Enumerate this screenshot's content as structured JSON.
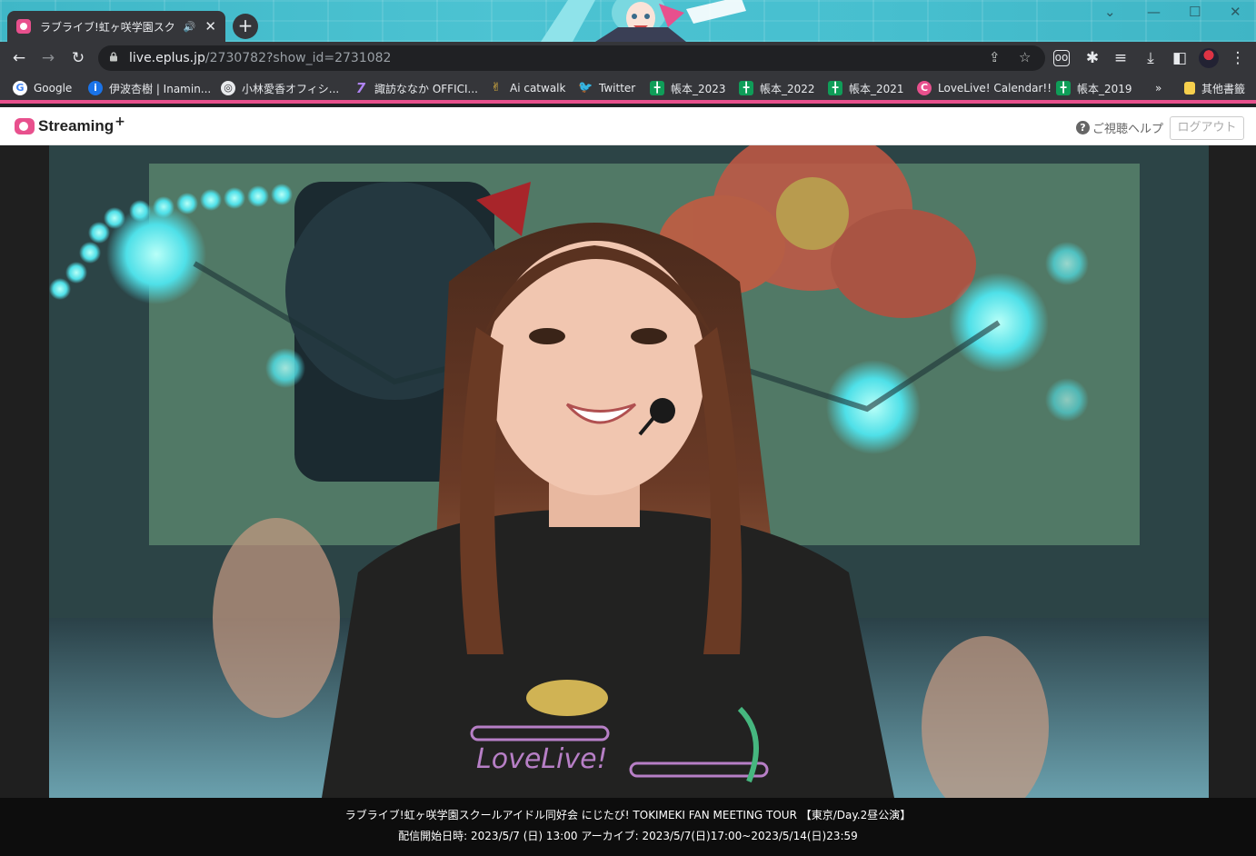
{
  "browser": {
    "tab_title": "ラブライブ!虹ヶ咲学園スク",
    "tab_audio_icon": "speaker-icon",
    "url_host": "live.eplus.jp",
    "url_path": "/2730782?show_id=2731082"
  },
  "bookmarks": [
    {
      "label": "Google",
      "icon": "google-icon",
      "color": "#ffffff"
    },
    {
      "label": "伊波杏樹 | Inamin...",
      "icon": "info-icon",
      "color": "#1a73e8"
    },
    {
      "label": "小林愛香オフィシ...",
      "icon": "globe-icon",
      "color": "#e8eaed"
    },
    {
      "label": "諏訪ななか OFFICI...",
      "icon": "seven-icon",
      "color": "#b084f5"
    },
    {
      "label": "Ai catwalk",
      "icon": "cat-icon",
      "color": "#f0c040"
    },
    {
      "label": "Twitter",
      "icon": "twitter-icon",
      "color": "#1d9bf0"
    },
    {
      "label": "帳本_2023",
      "icon": "sheets-icon",
      "color": "#0f9d58"
    },
    {
      "label": "帳本_2022",
      "icon": "sheets-icon",
      "color": "#0f9d58"
    },
    {
      "label": "帳本_2021",
      "icon": "sheets-icon",
      "color": "#0f9d58"
    },
    {
      "label": "LoveLive! Calendar!!",
      "icon": "calendar-icon",
      "color": "#e8508d"
    },
    {
      "label": "帳本_2019",
      "icon": "sheets-icon",
      "color": "#0f9d58"
    }
  ],
  "bookmarks_more": "»",
  "other_bookmarks": "其他書籤",
  "page": {
    "logo_text": "Streaming",
    "logo_plus": "+",
    "help_label": "ご視聴ヘルプ",
    "logout_label": "ログアウト"
  },
  "event": {
    "title": "ラブライブ!虹ヶ咲学園スクールアイドル同好会 にじたび! TOKIMEKI FAN MEETING TOUR 【東京/Day.2昼公演】",
    "schedule": "配信開始日時: 2023/5/7 (日) 13:00 アーカイブ: 2023/5/7(日)17:00~2023/5/14(日)23:59"
  },
  "video_shirt_text": "LoveLive!",
  "colors": {
    "accent": "#e8508d",
    "tabstrip": "#47bfcf"
  }
}
